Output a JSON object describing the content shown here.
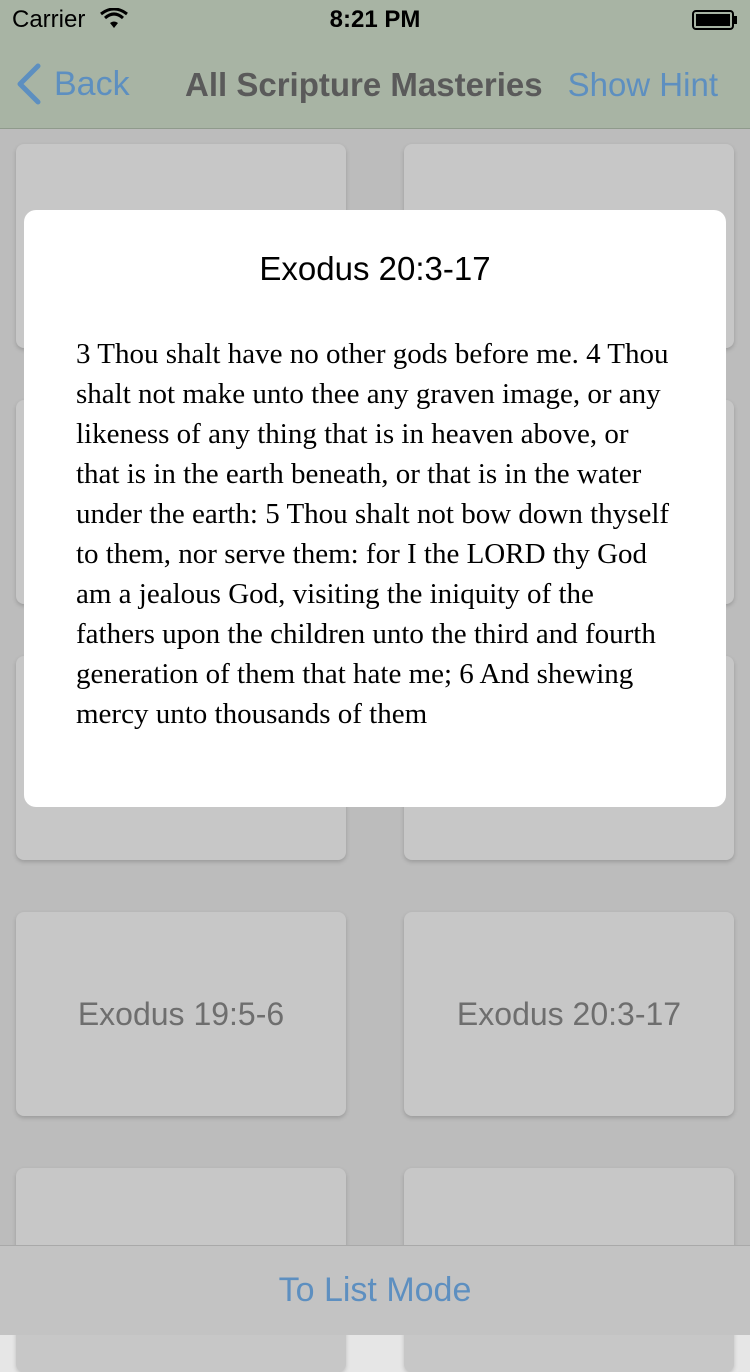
{
  "status": {
    "carrier": "Carrier",
    "time": "8:21 PM"
  },
  "nav": {
    "back_label": "Back",
    "title": "All Scripture Masteries",
    "hint_label": "Show Hint"
  },
  "cards": [
    {
      "label": ""
    },
    {
      "label": ""
    },
    {
      "label": ""
    },
    {
      "label": ""
    },
    {
      "label": ""
    },
    {
      "label": ""
    },
    {
      "label": "Exodus 19:5-6"
    },
    {
      "label": "Exodus 20:3-17"
    },
    {
      "label": ""
    },
    {
      "label": ""
    }
  ],
  "modal": {
    "title": "Exodus 20:3-17",
    "text": "3 Thou shalt have no other gods before me. 4 Thou shalt not make unto thee any graven image, or any likeness of any thing that is in heaven above, or that is in the earth beneath, or that is in the water under the earth: 5 Thou shalt not bow down thyself to them, nor serve them: for I the LORD thy God am a jealous God, visiting the iniquity of the fathers upon the children unto the third and fourth generation of them that hate me; 6 And shewing mercy unto thousands of them"
  },
  "bottom": {
    "list_mode_label": "To List Mode"
  },
  "colors": {
    "accent": "#5d8fc0",
    "nav_background": "#a8b4a4"
  }
}
